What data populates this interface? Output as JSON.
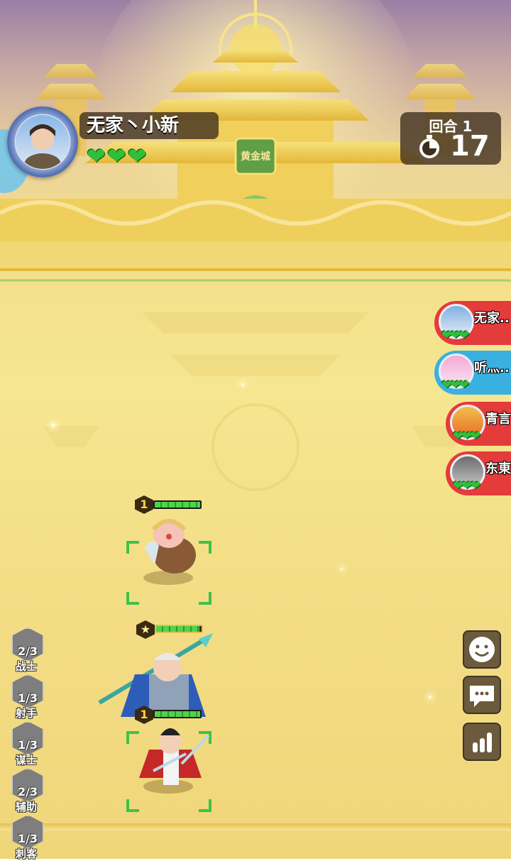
{
  "player": {
    "name": "无家丶小新",
    "lives": "❤❤❤"
  },
  "round": {
    "label": "回合 1",
    "timer": "17"
  },
  "palace_sign": "黄金城",
  "player_list": [
    {
      "name": "无家..",
      "lives": "❤❤❤",
      "color": "#e43b3b"
    },
    {
      "name": "听灬..",
      "lives": "❤❤❤",
      "color": "#3ab0e0"
    },
    {
      "name": "青言",
      "lives": "❤❤❤",
      "color": "#e43b3b"
    },
    {
      "name": "东東",
      "lives": "❤❤❤",
      "color": "#e43b3b"
    }
  ],
  "units": [
    {
      "star": "1",
      "hp": 100
    },
    {
      "star": "★",
      "hp": 95
    },
    {
      "star": "1",
      "hp": 100
    }
  ],
  "classes": [
    {
      "count": "2/3",
      "label": "战士",
      "icon": "warrior-icon"
    },
    {
      "count": "1/3",
      "label": "射手",
      "icon": "archer-icon"
    },
    {
      "count": "1/3",
      "label": "谋士",
      "icon": "strategist-icon"
    },
    {
      "count": "2/3",
      "label": "辅助",
      "icon": "support-icon"
    },
    {
      "count": "1/3",
      "label": "刺客",
      "icon": "assassin-icon"
    }
  ],
  "buttons": {
    "emoji": "emoji-icon",
    "chat": "chat-icon",
    "stats": "stats-icon"
  },
  "colors": {
    "heart_green": "#2fbf3a",
    "panel": "#3c2d1e",
    "accent_gold": "#f3dd85"
  }
}
